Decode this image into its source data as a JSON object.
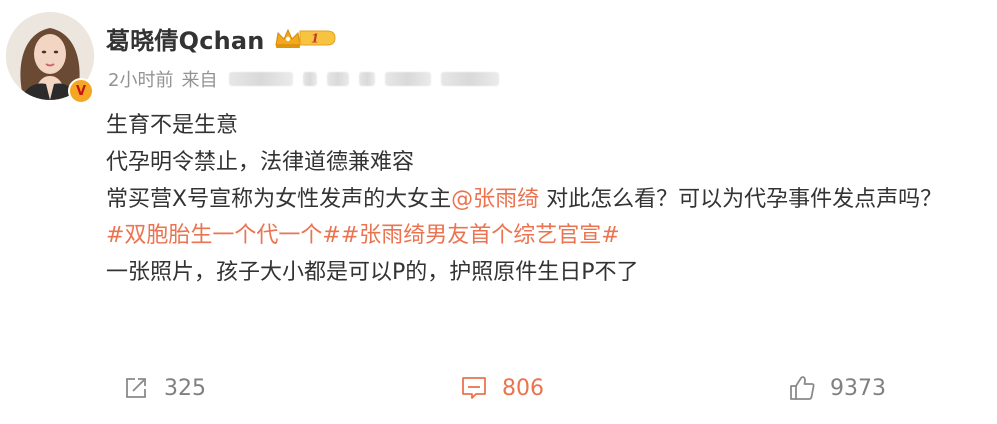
{
  "post": {
    "author": {
      "name": "葛晓倩Qchan",
      "verified_badge_icon": "verified-v-badge-icon",
      "vip_icon": "crown-vip-level-1-icon",
      "vip_level": "1"
    },
    "meta": {
      "time": "2小时前",
      "from_label": "来自"
    },
    "content": {
      "line1": "生育不是生意",
      "line2": "代孕明令禁止，法律道德兼难容",
      "line3_prefix": "常买营X号宣称为女性发声的大女主",
      "line3_mention": "@张雨绮",
      "line3_suffix": " 对此怎么看？可以为代孕事件发点声吗？",
      "topic1": "#双胞胎生一个代一个#",
      "topic2": "#张雨绮男友首个综艺官宣#",
      "line5": "一张照片，孩子大小都是可以P的，护照原件生日P不了"
    },
    "actions": {
      "repost_count": "325",
      "comment_count": "806",
      "like_count": "9373"
    }
  },
  "colors": {
    "accent": "#eb7350",
    "text": "#333333",
    "meta": "#939393",
    "action": "#808080"
  }
}
